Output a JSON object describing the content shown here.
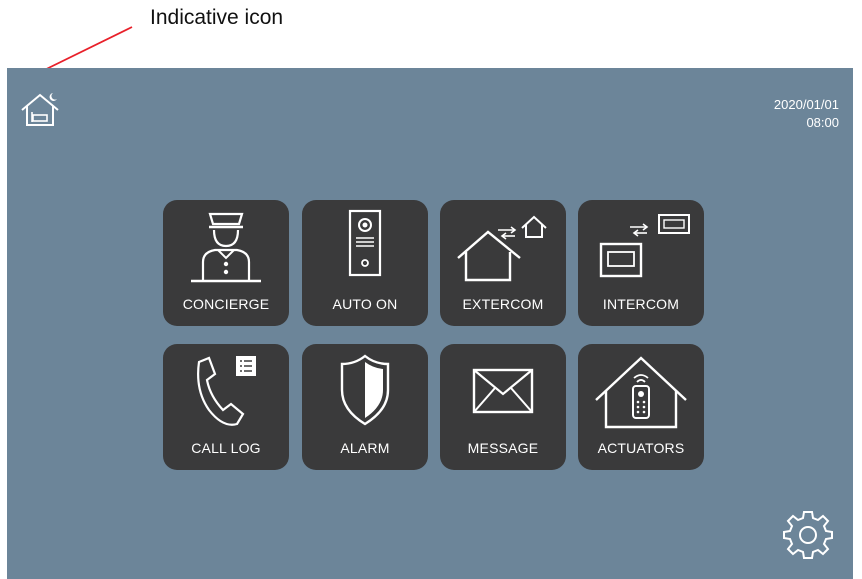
{
  "annotation": {
    "label": "Indicative icon"
  },
  "status": {
    "date": "2020/01/01",
    "time": "08:00",
    "indicator_icon": "home-night-icon"
  },
  "tiles": [
    {
      "label": "CONCIERGE",
      "icon": "concierge-icon"
    },
    {
      "label": "AUTO ON",
      "icon": "door-station-icon"
    },
    {
      "label": "EXTERCOM",
      "icon": "extercom-icon"
    },
    {
      "label": "INTERCOM",
      "icon": "intercom-icon"
    },
    {
      "label": "CALL LOG",
      "icon": "call-log-icon"
    },
    {
      "label": "ALARM",
      "icon": "shield-icon"
    },
    {
      "label": "MESSAGE",
      "icon": "envelope-icon"
    },
    {
      "label": "ACTUATORS",
      "icon": "remote-house-icon"
    }
  ],
  "settings": {
    "icon": "gear-icon"
  },
  "colors": {
    "screen_background": "#6c8599",
    "tile_background": "#3a3a3b",
    "annotation_arrow": "#e8202a"
  }
}
